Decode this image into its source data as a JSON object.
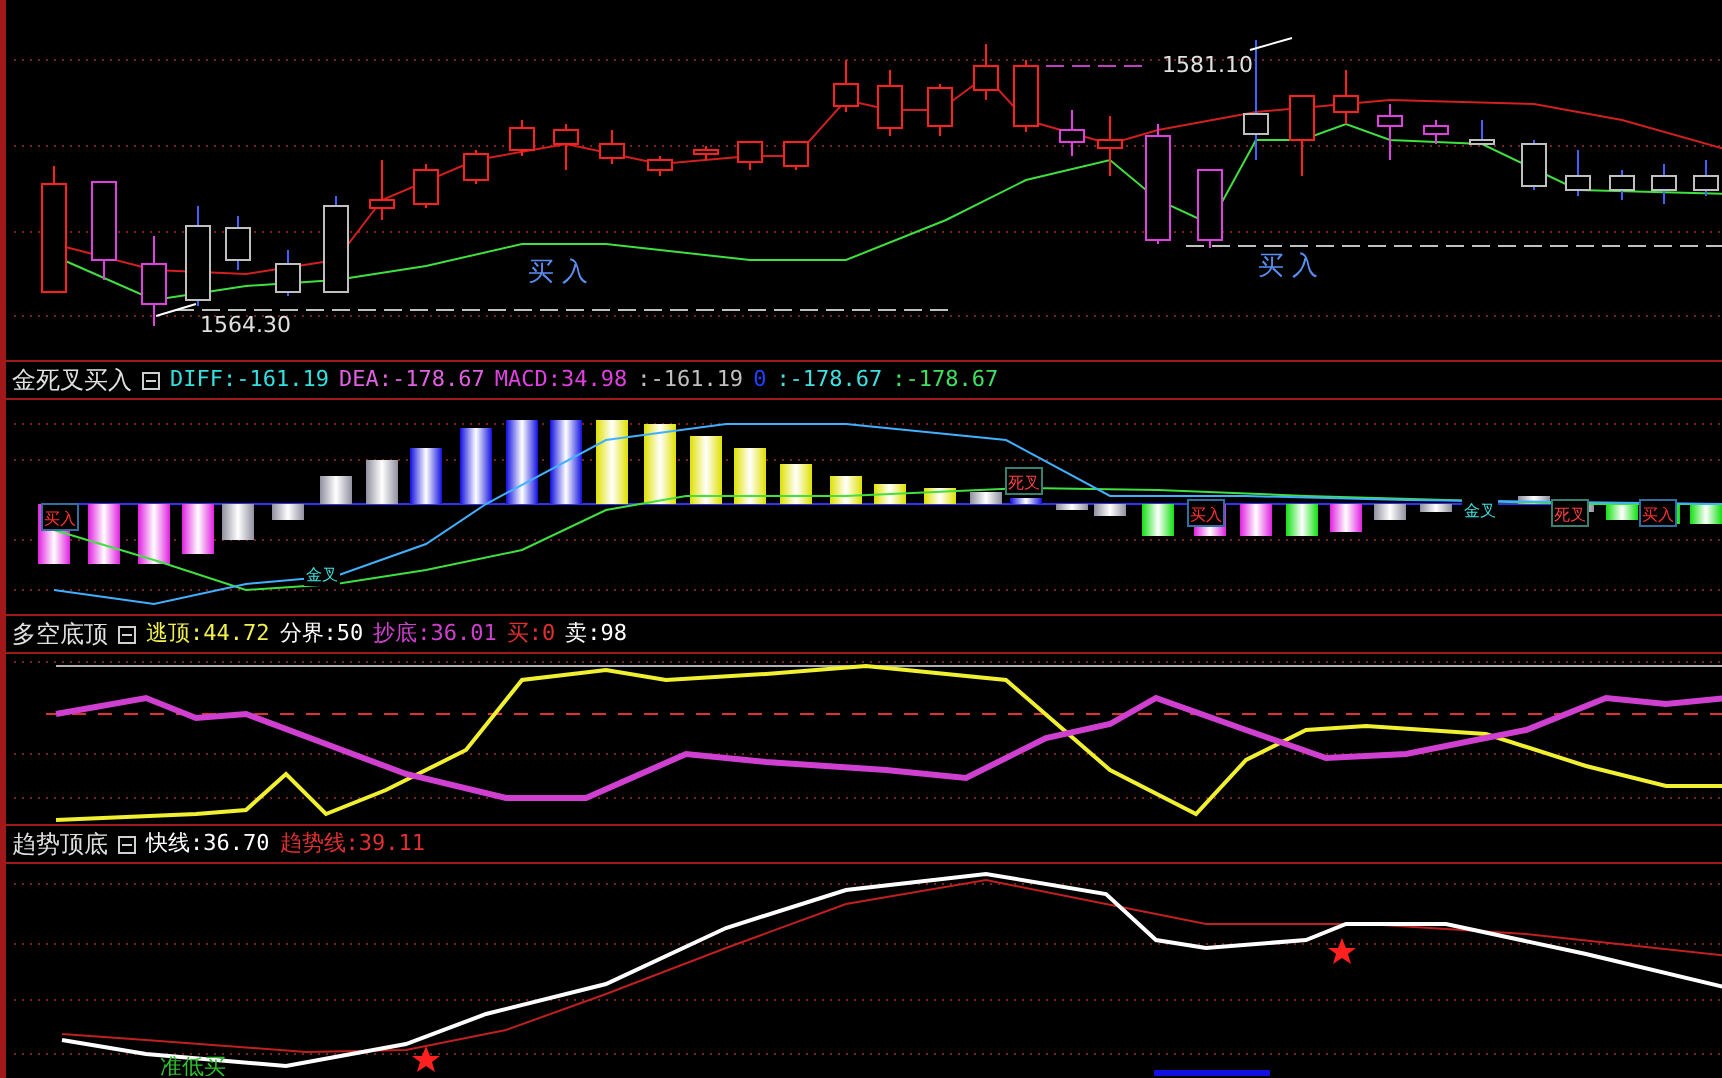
{
  "price_panel": {
    "high_label": "1581.10",
    "low_label": "1564.30",
    "signals": [
      "买 入",
      "买 入"
    ]
  },
  "macd_panel": {
    "title": "金死叉买入",
    "readouts": [
      "DIFF:-161.19",
      "DEA:-178.67",
      "MACD:34.98",
      ":-161.19",
      "0",
      ":-178.67",
      ":-178.67"
    ],
    "signals": [
      {
        "text": "买入",
        "kind": "buy"
      },
      {
        "text": "金叉",
        "kind": "golden"
      },
      {
        "text": "死叉",
        "kind": "dead"
      },
      {
        "text": "买入",
        "kind": "buy"
      },
      {
        "text": "金叉",
        "kind": "golden"
      },
      {
        "text": "死叉",
        "kind": "dead"
      },
      {
        "text": "买入",
        "kind": "buy"
      }
    ]
  },
  "bull_bear_panel": {
    "title": "多空底顶",
    "readouts": [
      "逃顶:44.72",
      "分界:50",
      "抄底:36.01",
      "买:0",
      "卖:98"
    ]
  },
  "trend_panel": {
    "title": "趋势顶底",
    "readouts": [
      "快线:36.70",
      "趋势线:39.11"
    ],
    "signal": "准低买"
  }
}
